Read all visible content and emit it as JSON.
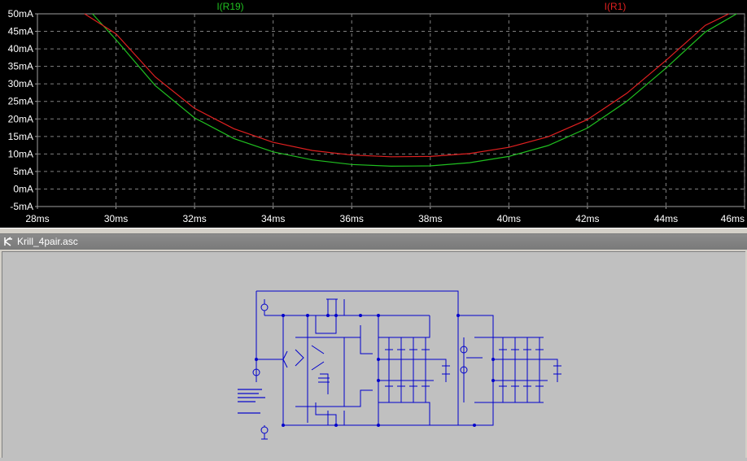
{
  "waveform": {
    "y_ticks": [
      "50mA",
      "45mA",
      "40mA",
      "35mA",
      "30mA",
      "25mA",
      "20mA",
      "15mA",
      "10mA",
      "5mA",
      "0mA",
      "-5mA"
    ],
    "x_ticks": [
      "28ms",
      "30ms",
      "32ms",
      "34ms",
      "36ms",
      "38ms",
      "40ms",
      "42ms",
      "44ms",
      "46ms"
    ],
    "colors": {
      "background": "#000000",
      "grid": "#808080",
      "axis_text": "#ffffff"
    }
  },
  "chart_data": {
    "type": "line",
    "xlim": [
      28,
      46
    ],
    "ylim": [
      -5,
      50
    ],
    "grid": true,
    "series": [
      {
        "name": "I(R19)",
        "color": "#20c020",
        "x": [
          29.4,
          30,
          31,
          32,
          33,
          34,
          35,
          36,
          37,
          38,
          39,
          40,
          41,
          42,
          43,
          44,
          45,
          45.8
        ],
        "y": [
          50,
          42.6,
          29.5,
          20.3,
          14.4,
          10.6,
          8.3,
          7.0,
          6.5,
          6.6,
          7.5,
          9.3,
          12.4,
          17.4,
          25.0,
          34.5,
          44.8,
          50
        ]
      },
      {
        "name": "I(R1)",
        "color": "#e02020",
        "x": [
          29.2,
          30,
          31,
          32,
          33,
          34,
          35,
          36,
          37,
          38,
          39,
          40,
          41,
          42,
          43,
          44,
          45,
          45.6
        ],
        "y": [
          50,
          44.3,
          32.0,
          23.0,
          17.2,
          13.3,
          11.0,
          9.7,
          9.2,
          9.3,
          10.1,
          11.9,
          14.9,
          19.8,
          27.3,
          36.7,
          46.7,
          50
        ]
      }
    ]
  },
  "schematic": {
    "window_title": "Krill_4pair.asc",
    "wire_color": "#0000cc"
  }
}
